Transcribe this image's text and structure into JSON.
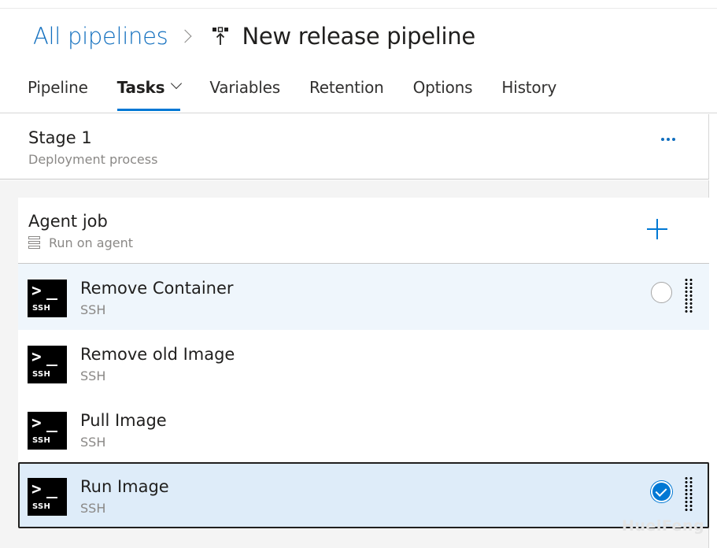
{
  "breadcrumb": {
    "root_link": "All pipelines",
    "separator_icon": "chevron-right-icon",
    "pipeline_icon": "release-pipeline-icon",
    "pipeline_name": "New release pipeline"
  },
  "tabs": [
    {
      "label": "Pipeline",
      "active": false
    },
    {
      "label": "Tasks",
      "active": true,
      "has_dropdown": true
    },
    {
      "label": "Variables",
      "active": false
    },
    {
      "label": "Retention",
      "active": false
    },
    {
      "label": "Options",
      "active": false
    },
    {
      "label": "History",
      "active": false
    }
  ],
  "stage": {
    "title": "Stage 1",
    "subtitle": "Deployment process",
    "more_icon": "ellipsis-icon"
  },
  "agent_job": {
    "title": "Agent job",
    "subtitle": "Run on agent",
    "agent_icon": "server-icon",
    "add_icon": "plus-icon"
  },
  "tasks": [
    {
      "title": "Remove Container",
      "type": "SSH",
      "state": "hover"
    },
    {
      "title": "Remove old Image",
      "type": "SSH",
      "state": "normal"
    },
    {
      "title": "Pull Image",
      "type": "SSH",
      "state": "normal"
    },
    {
      "title": "Run Image",
      "type": "SSH",
      "state": "selected"
    }
  ],
  "ssh_icon": {
    "prompt": ">",
    "label": "SSH"
  },
  "watermark": "HueiFeng",
  "colors": {
    "accent": "#0078d4",
    "link": "#106ebe",
    "selected_bg": "#deecf9",
    "hover_bg": "#eff6fc"
  }
}
